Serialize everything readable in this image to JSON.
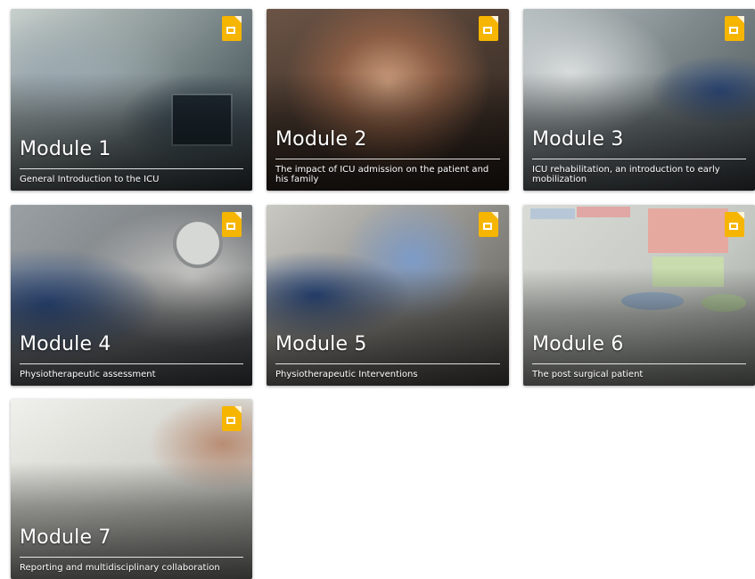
{
  "accent_color": "#f6b500",
  "modules": [
    {
      "title": "Module 1",
      "subtitle": "General Introduction to the ICU",
      "icon": "slides-icon"
    },
    {
      "title": "Module 2",
      "subtitle": "The impact of ICU admission on the patient and his family",
      "icon": "slides-icon"
    },
    {
      "title": "Module 3",
      "subtitle": "ICU rehabilitation, an introduction to early mobilization",
      "icon": "slides-icon"
    },
    {
      "title": "Module 4",
      "subtitle": "Physiotherapeutic assessment",
      "icon": "slides-icon"
    },
    {
      "title": "Module 5",
      "subtitle": "Physiotherapeutic Interventions",
      "icon": "slides-icon"
    },
    {
      "title": "Module 6",
      "subtitle": "The post surgical patient",
      "icon": "slides-icon"
    },
    {
      "title": "Module 7",
      "subtitle": "Reporting and multidisciplinary collaboration",
      "icon": "slides-icon"
    }
  ]
}
